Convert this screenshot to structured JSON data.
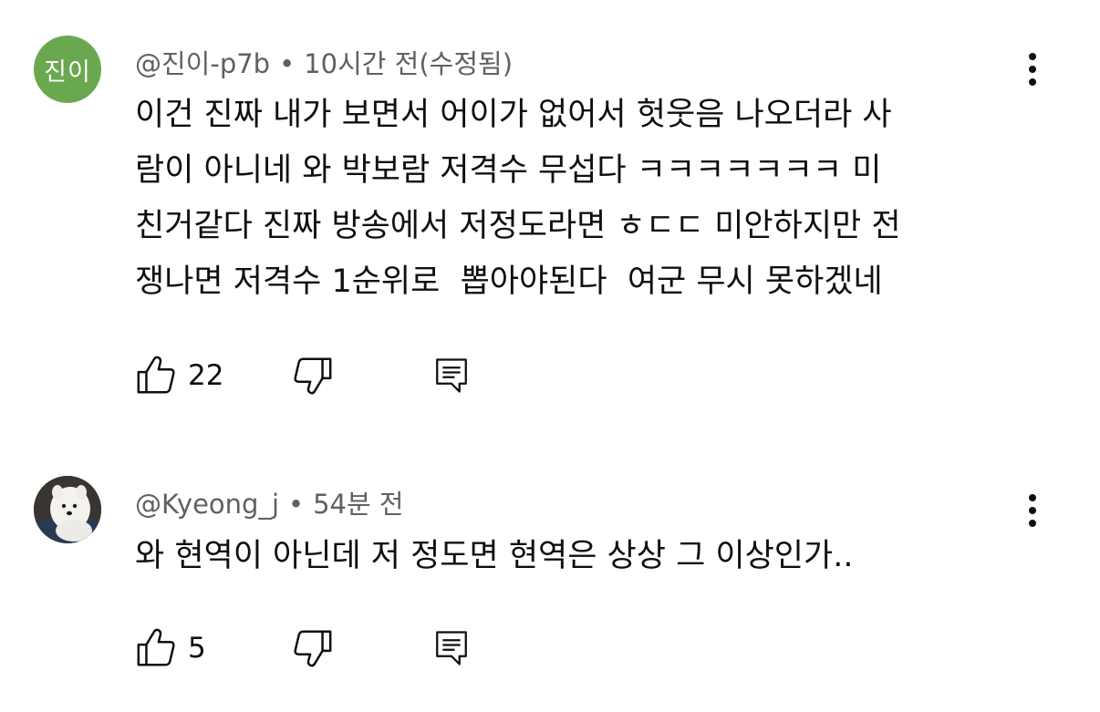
{
  "comments": [
    {
      "avatar_text": "진이",
      "avatar_color": "#6aa84f",
      "author": "@진이-p7b",
      "separator": "•",
      "time": "10시간 전(수정됨)",
      "text": "이건 진짜 내가 보면서 어이가 없어서 헛웃음 나오더라 사\n람이 아니네 와 박보람 저격수 무섭다 ㅋㅋㅋㅋㅋㅋㅋ 미\n친거같다 진짜 방송에서 저정도라면 ㅎㄷㄷ 미안하지만 전\n쟁나면 저격수 1순위로  뽑아야된다  여군 무시 못하겠네",
      "like_count": "22",
      "icons": {
        "like": "thumbs-up-icon",
        "dislike": "thumbs-down-icon",
        "reply": "reply-icon",
        "more": "more-vertical-icon"
      }
    },
    {
      "avatar_desc": "white-dog-photo",
      "author": "@Kyeong_j",
      "separator": "•",
      "time": "54분 전",
      "text": "와 현역이 아닌데 저 정도면 현역은 상상 그 이상인가..",
      "like_count": "5",
      "icons": {
        "like": "thumbs-up-icon",
        "dislike": "thumbs-down-icon",
        "reply": "reply-icon",
        "more": "more-vertical-icon"
      }
    }
  ]
}
